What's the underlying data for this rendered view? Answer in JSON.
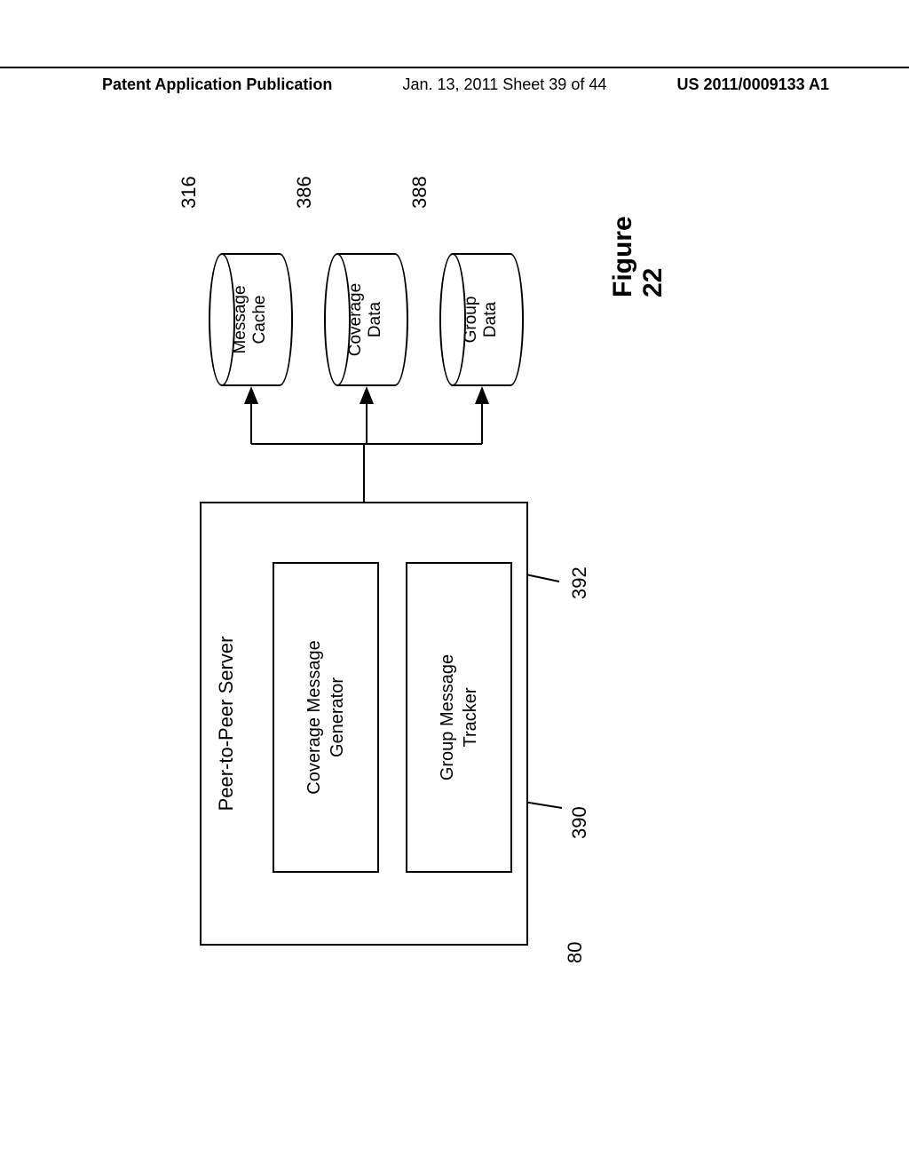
{
  "header": {
    "left": "Patent Application Publication",
    "center": "Jan. 13, 2011  Sheet 39 of 44",
    "right": "US 2011/0009133 A1"
  },
  "diagram": {
    "server_title": "Peer-to-Peer Server",
    "coverage_generator": "Coverage Message\nGenerator",
    "group_tracker": "Group Message\nTracker",
    "cylinders": {
      "message_cache": "Message\nCache",
      "coverage_data": "Coverage\nData",
      "group_data": "Group\nData"
    },
    "refs": {
      "r80": "80",
      "r390": "390",
      "r392": "392",
      "r316": "316",
      "r386": "386",
      "r388": "388"
    },
    "figure_label": "Figure 22"
  }
}
